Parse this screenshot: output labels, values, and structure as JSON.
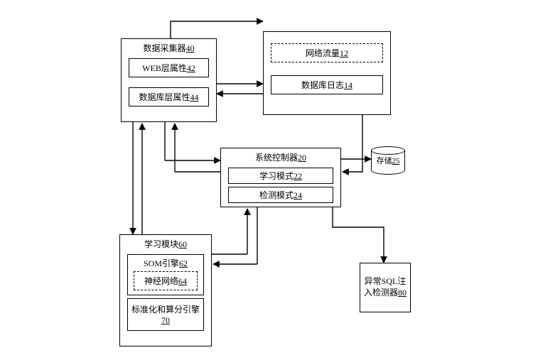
{
  "diagram": {
    "collector": {
      "title": "数据采集器",
      "num": "40",
      "web": {
        "label": "WEB层属性",
        "num": "42"
      },
      "db": {
        "label": "数据库层属性",
        "num": "44"
      }
    },
    "traffic": {
      "label": "网络流量",
      "num": "12"
    },
    "dblog": {
      "label": "数据库日志",
      "num": "14"
    },
    "controller": {
      "title": "系统控制器",
      "num": "20",
      "learn": {
        "label": "学习模式",
        "num": "22"
      },
      "detect": {
        "label": "检测模式",
        "num": "24"
      }
    },
    "storage": {
      "label": "存储",
      "num": "25"
    },
    "learner": {
      "title": "学习模块",
      "num": "60",
      "som": {
        "label": "SOM引擎",
        "num": "62"
      },
      "nn": {
        "label": "神经网络",
        "num": "64"
      },
      "norm": {
        "label": "标准化和算分引擎",
        "num": "70"
      }
    },
    "detector": {
      "label": "异常SQL注入检测器",
      "num": "80"
    }
  }
}
